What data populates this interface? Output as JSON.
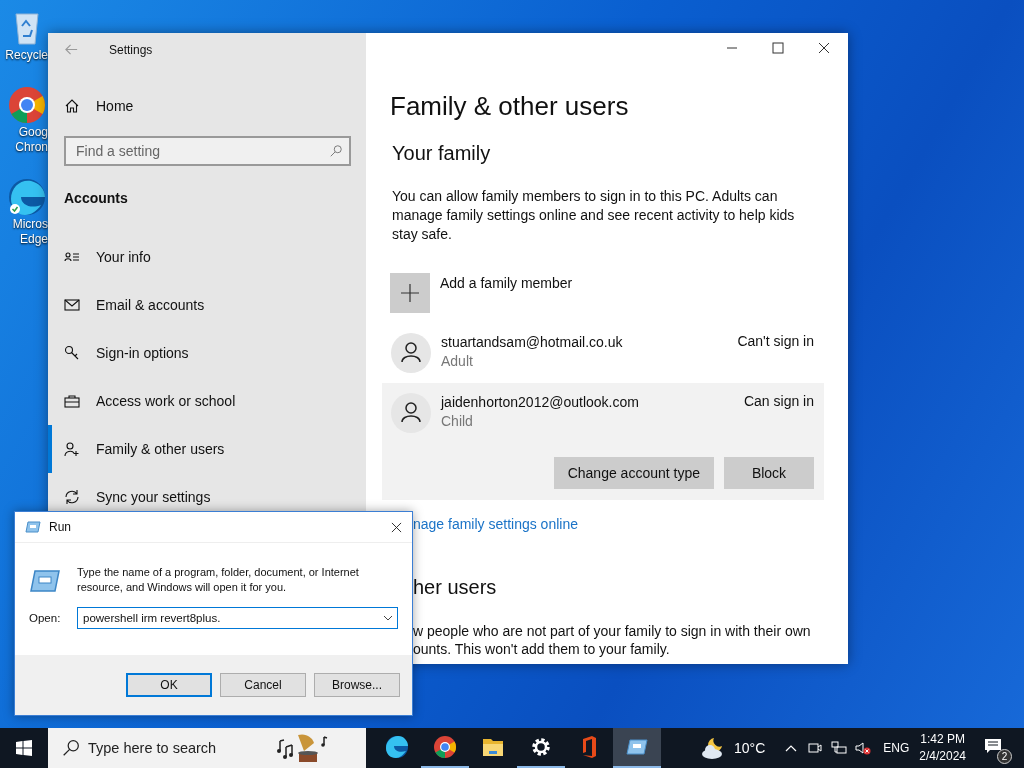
{
  "desktop_icons": [
    {
      "kind": "recycle",
      "lines": [
        "Recycle"
      ]
    },
    {
      "kind": "chrome",
      "lines": [
        "Goog",
        "Chron"
      ]
    },
    {
      "kind": "edge",
      "lines": [
        "Micros",
        "Edge"
      ]
    }
  ],
  "settings": {
    "title": "Settings",
    "home": "Home",
    "search": {
      "placeholder": "Find a setting"
    },
    "section": "Accounts",
    "nav_items": [
      {
        "kind": "info",
        "label": "Your info",
        "selected": false
      },
      {
        "kind": "email",
        "label": "Email & accounts",
        "selected": false
      },
      {
        "kind": "key",
        "label": "Sign-in options",
        "selected": false
      },
      {
        "kind": "work",
        "label": "Access work or school",
        "selected": false
      },
      {
        "kind": "family",
        "label": "Family & other users",
        "selected": true
      },
      {
        "kind": "sync",
        "label": "Sync your settings",
        "selected": false
      }
    ],
    "heading": "Family & other users",
    "family": {
      "title": "Your family",
      "description": "You can allow family members to sign in to this PC. Adults can manage family settings online and see recent activity to help kids stay safe.",
      "add_label": "Add a family member",
      "members": [
        {
          "email": "stuartandsam@hotmail.co.uk",
          "role": "Adult",
          "status": "Can't sign in",
          "selected": false
        },
        {
          "email": "jaidenhorton2012@outlook.com",
          "role": "Child",
          "status": "Can sign in",
          "selected": true
        }
      ],
      "buttons": [
        "Change account type",
        "Block"
      ],
      "link": "nage family settings online"
    },
    "other_users": {
      "title": "her users",
      "lines": [
        "w people who are not part of your family to sign in with their own",
        "ounts. This won't add them to your family."
      ]
    }
  },
  "run_dialog": {
    "title": "Run",
    "description": "Type the name of a program, folder, document, or Internet resource, and Windows will open it for you.",
    "open_label": "Open:",
    "value": "powershell irm revert8plus.",
    "buttons": [
      {
        "label": "OK",
        "focused": true
      },
      {
        "label": "Cancel",
        "focused": false
      },
      {
        "label": "Browse...",
        "focused": false
      }
    ]
  },
  "taskbar": {
    "search_placeholder": "Type here to search",
    "apps": [
      {
        "kind": "edge",
        "running": false,
        "selected": false
      },
      {
        "kind": "chrome",
        "running": true,
        "selected": false
      },
      {
        "kind": "folder",
        "running": false,
        "selected": false
      },
      {
        "kind": "settings",
        "running": true,
        "selected": false
      },
      {
        "kind": "office",
        "running": false,
        "selected": false
      },
      {
        "kind": "run",
        "running": true,
        "selected": true
      }
    ],
    "temperature": "10°C",
    "language": "ENG",
    "time": "1:42 PM",
    "date": "2/4/2024",
    "notification_count": "2"
  }
}
